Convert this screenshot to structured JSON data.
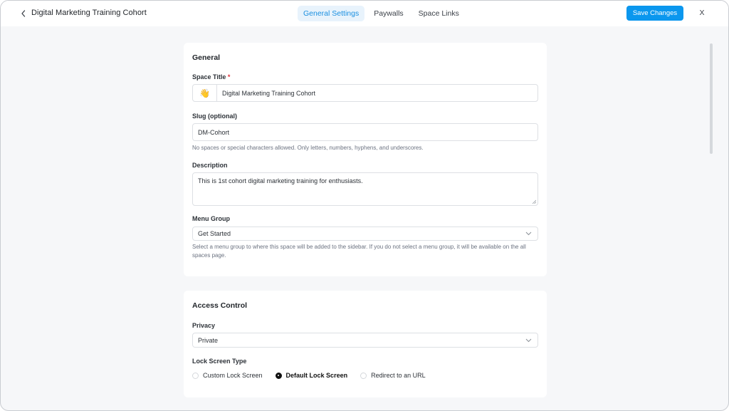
{
  "header": {
    "title": "Digital Marketing Training Cohort",
    "tabs": [
      {
        "label": "General Settings",
        "active": true
      },
      {
        "label": "Paywalls",
        "active": false
      },
      {
        "label": "Space Links",
        "active": false
      }
    ],
    "save_label": "Save Changes",
    "close_label": "X"
  },
  "general": {
    "heading": "General",
    "space_title": {
      "label": "Space Title",
      "required_mark": "*",
      "emoji": "👋",
      "value": "Digital Marketing Training Cohort"
    },
    "slug": {
      "label": "Slug (optional)",
      "value": "DM-Cohort",
      "help": "No spaces or special characters allowed. Only letters, numbers, hyphens, and underscores."
    },
    "description": {
      "label": "Description",
      "value": "This is 1st cohort digital marketing training for enthusiasts."
    },
    "menu_group": {
      "label": "Menu Group",
      "value": "Get Started",
      "help": "Select a menu group to where this space will be added to the sidebar. If you do not select a menu group, it will be available on the all spaces page."
    }
  },
  "access": {
    "heading": "Access Control",
    "privacy": {
      "label": "Privacy",
      "value": "Private"
    },
    "lock_screen": {
      "label": "Lock Screen Type",
      "options": [
        {
          "label": "Custom Lock Screen",
          "selected": false
        },
        {
          "label": "Default Lock Screen",
          "selected": true
        },
        {
          "label": "Redirect to an URL",
          "selected": false
        }
      ]
    }
  },
  "colors": {
    "accent": "#0b97ee",
    "active_tab_bg": "#e8f3fc",
    "active_tab_text": "#1a8fe0",
    "required": "#e0303a"
  },
  "icons": [
    "chevron-left-icon",
    "chevron-down-icon",
    "resize-grip-icon",
    "waving-hand-emoji"
  ]
}
